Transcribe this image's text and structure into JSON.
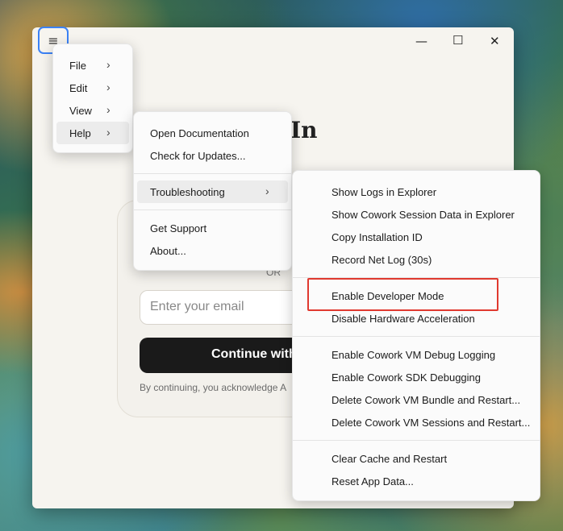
{
  "window": {
    "heading_partial": "In",
    "controls": {
      "minimize": "—",
      "maximize": "☐",
      "close": "✕"
    }
  },
  "login": {
    "or_label": "OR",
    "email_placeholder": "Enter your email",
    "continue_label": "Continue with",
    "terms_text": "By continuing, you acknowledge A"
  },
  "menus": {
    "main": [
      {
        "label": "File"
      },
      {
        "label": "Edit"
      },
      {
        "label": "View"
      },
      {
        "label": "Help"
      }
    ],
    "help": [
      {
        "label": "Open Documentation"
      },
      {
        "label": "Check for Updates..."
      },
      {
        "label": "Troubleshooting"
      },
      {
        "label": "Get Support"
      },
      {
        "label": "About..."
      }
    ],
    "troubleshooting": [
      {
        "label": "Show Logs in Explorer"
      },
      {
        "label": "Show Cowork Session Data in Explorer"
      },
      {
        "label": "Copy Installation ID"
      },
      {
        "label": "Record Net Log (30s)"
      },
      {
        "label": "Enable Developer Mode"
      },
      {
        "label": "Disable Hardware Acceleration"
      },
      {
        "label": "Enable Cowork VM Debug Logging"
      },
      {
        "label": "Enable Cowork SDK Debugging"
      },
      {
        "label": "Delete Cowork VM Bundle and Restart..."
      },
      {
        "label": "Delete Cowork VM Sessions and Restart..."
      },
      {
        "label": "Clear Cache and Restart"
      },
      {
        "label": "Reset App Data..."
      }
    ]
  },
  "colors": {
    "highlight": "#e0392f",
    "focus_ring": "#3b82f6",
    "button_bg": "#1a1a1a"
  },
  "icons": {
    "hamburger": "hamburger-menu-icon",
    "submenu": "chevron-right-icon"
  }
}
